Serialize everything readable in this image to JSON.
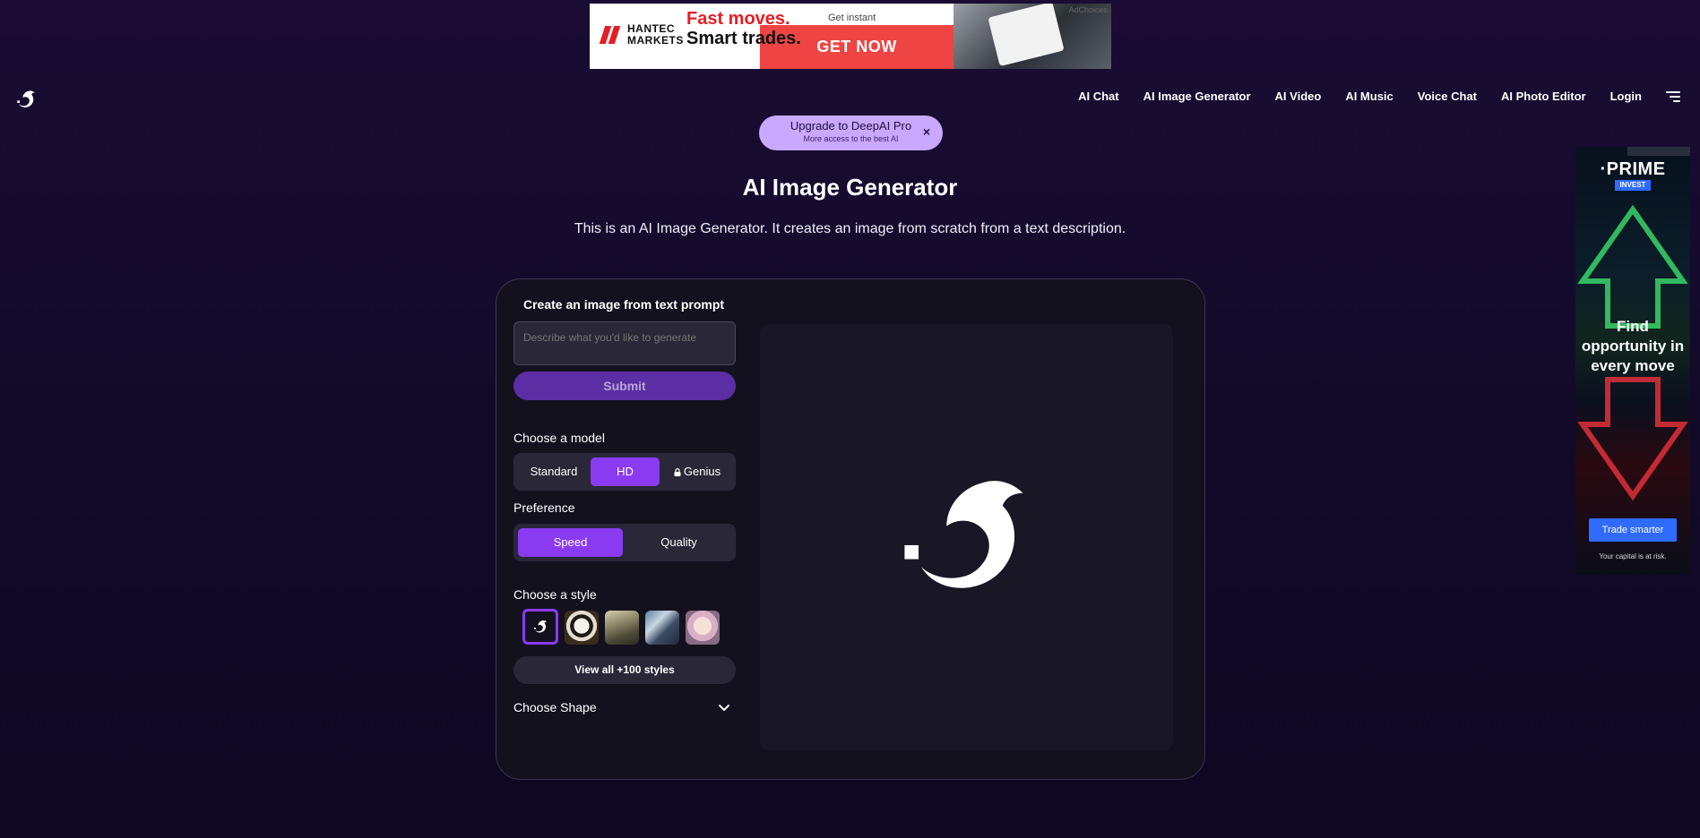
{
  "top_ad": {
    "brand_line1": "HANTEC",
    "brand_line2": "MARKETS",
    "headline1": "Fast moves.",
    "headline2": "Smart trades.",
    "small_text": "Get instant",
    "cta": "GET NOW",
    "adchoices": "AdChoices"
  },
  "nav": {
    "items": [
      "AI Chat",
      "AI Image Generator",
      "AI Video",
      "AI Music",
      "Voice Chat",
      "AI Photo Editor",
      "Login"
    ]
  },
  "upgrade": {
    "title": "Upgrade to DeepAI Pro",
    "subtitle": "More access to the best AI",
    "close": "×"
  },
  "page": {
    "title": "AI Image Generator",
    "subtitle": "This is an AI Image Generator. It creates an image from scratch from a text description."
  },
  "form": {
    "prompt_label": "Create an image from text prompt",
    "prompt_placeholder": "Describe what you'd like to generate",
    "submit": "Submit",
    "model_label": "Choose a model",
    "models": [
      "Standard",
      "HD",
      "Genius"
    ],
    "model_selected": "HD",
    "genius_locked": true,
    "preference_label": "Preference",
    "preferences": [
      "Speed",
      "Quality"
    ],
    "preference_selected": "Speed",
    "style_label": "Choose a style",
    "styles_button": "View all +100 styles",
    "shape_label": "Choose Shape"
  },
  "side_ad": {
    "brand": "·PRIME",
    "tag": "INVEST",
    "copy": "Find opportunity in every move",
    "cta": "Trade smarter",
    "risk": "Your capital is at risk."
  },
  "colors": {
    "accent": "#8a3bf2",
    "submit_bg": "#5b2ea3",
    "upgrade_bg": "#c9a8ff",
    "page_bg": "#120a28"
  }
}
